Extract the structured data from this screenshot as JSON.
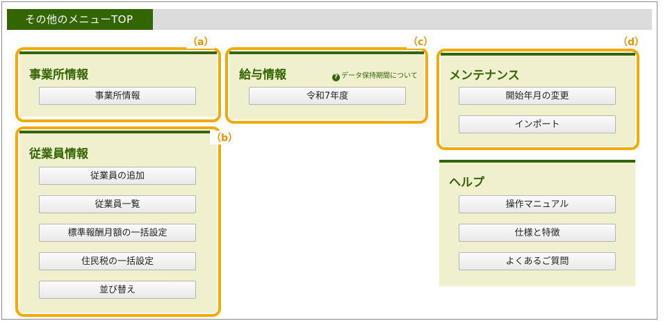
{
  "page": {
    "tab_title": "その他のメニューTOP"
  },
  "panels": {
    "office": {
      "title": "事業所情報",
      "mark": "（a）",
      "buttons": [
        "事業所情報"
      ]
    },
    "employee": {
      "title": "従業員情報",
      "mark": "（b）",
      "buttons": [
        "従業員の追加",
        "従業員一覧",
        "標準報酬月額の一括設定",
        "住民税の一括設定",
        "並び替え"
      ]
    },
    "salary": {
      "title": "給与情報",
      "mark": "（c）",
      "note": "データ保持期間について",
      "buttons": [
        "令和7年度"
      ]
    },
    "maintenance": {
      "title": "メンテナンス",
      "mark": "（d）",
      "buttons": [
        "開始年月の変更",
        "インポート"
      ]
    },
    "help": {
      "title": "ヘルプ",
      "buttons": [
        "操作マニュアル",
        "仕様と特徴",
        "よくあるご質問"
      ]
    }
  },
  "colors": {
    "accent_green": "#336600",
    "panel_bg": "#f0f0cf",
    "highlight": "#f2a900"
  }
}
